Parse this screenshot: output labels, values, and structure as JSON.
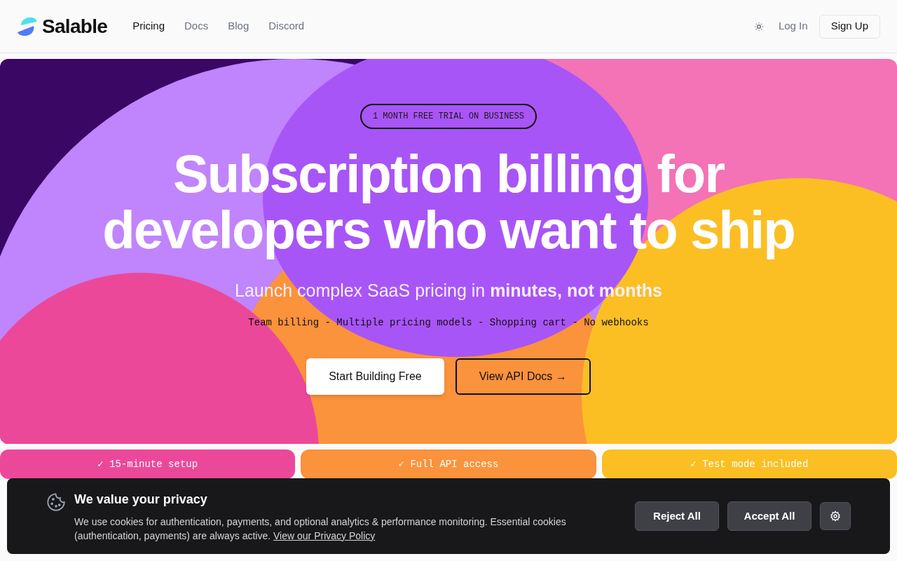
{
  "brand": {
    "name": "Salable"
  },
  "nav": [
    {
      "label": "Pricing",
      "selected": true
    },
    {
      "label": "Docs",
      "selected": false
    },
    {
      "label": "Blog",
      "selected": false
    },
    {
      "label": "Discord",
      "selected": false
    }
  ],
  "header_actions": {
    "login": "Log In",
    "signup": "Sign Up"
  },
  "hero": {
    "badge": "1 MONTH FREE TRIAL ON BUSINESS",
    "title_lines": [
      "Subscription billing for",
      "developers who want to ship"
    ],
    "subtitle": "Launch complex SaaS pricing in **minutes, not months**",
    "features_line": "Team billing - Multiple pricing models - Shopping cart - No webhooks",
    "primary_button": "Start Building Free",
    "secondary_button": "View API Docs →"
  },
  "highlights": [
    {
      "label": "✓ 15-minute setup",
      "color": "#ec4899"
    },
    {
      "label": "✓ Full API access",
      "color": "#fb923c"
    },
    {
      "label": "✓ Test mode included",
      "color": "#fbbf24"
    }
  ],
  "cookie_banner": {
    "title": "We value your privacy",
    "text": "We use cookies for authentication, payments, and optional analytics & performance monitoring. Essential cookies (authentication, payments) are always active.",
    "link": "View our Privacy Policy",
    "reject": "Reject All",
    "accept": "Accept All"
  }
}
